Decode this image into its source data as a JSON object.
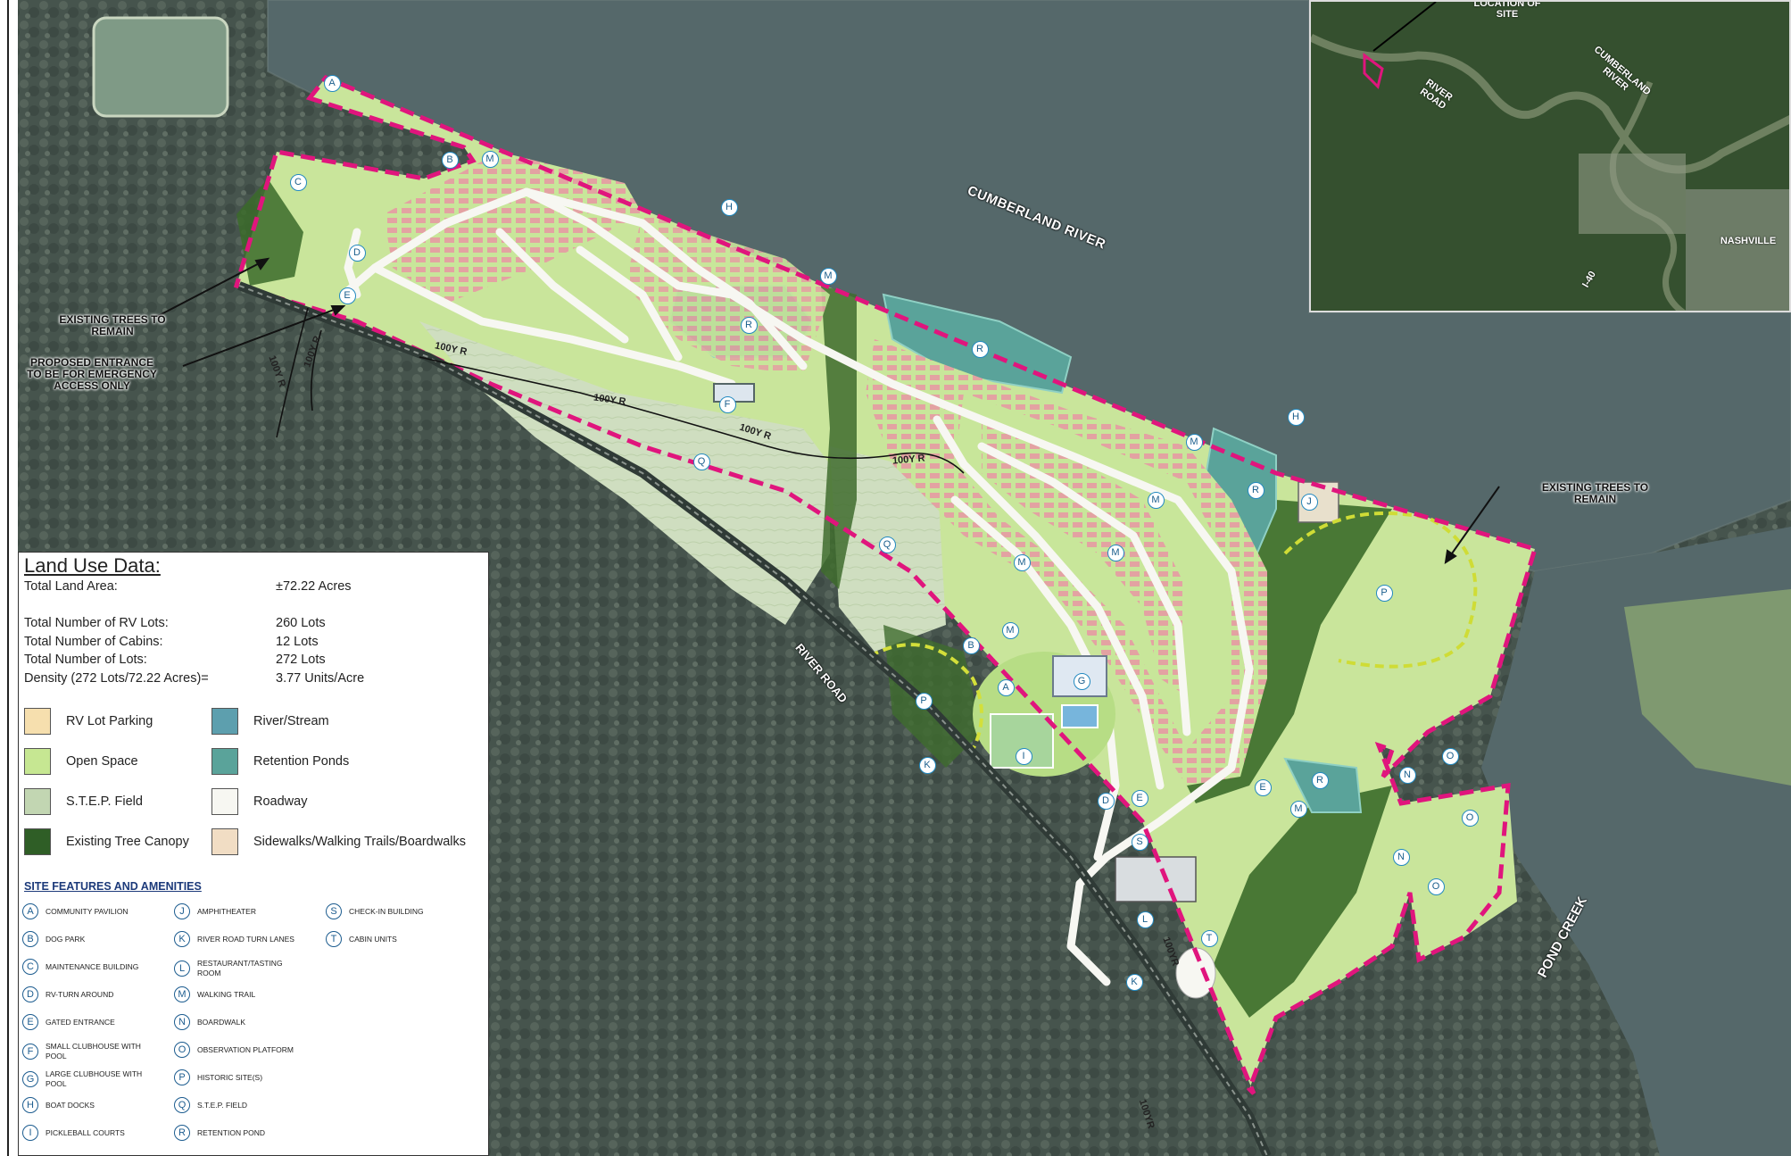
{
  "map": {
    "labels": {
      "cumberland_river": "CUMBERLAND RIVER",
      "river_road": "RIVER ROAD",
      "pond_creek": "POND CREEK",
      "existing_trees_left": "EXISTING TREES TO REMAIN",
      "existing_trees_right": "EXISTING TREES TO REMAIN",
      "emergency_entrance": "PROPOSED ENTRANCE TO BE FOR EMERGENCY ACCESS ONLY"
    },
    "flood_labels": [
      "100Y R",
      "100Y R",
      "100Y R",
      "100Y R",
      "100Y R",
      "100Y R",
      "100YR",
      "100YR"
    ],
    "markers": [
      {
        "id": "m-a1",
        "letter": "A"
      },
      {
        "id": "m-b1",
        "letter": "B"
      },
      {
        "id": "m-m1",
        "letter": "M"
      },
      {
        "id": "m-c",
        "letter": "C"
      },
      {
        "id": "m-d1",
        "letter": "D"
      },
      {
        "id": "m-e1",
        "letter": "E"
      },
      {
        "id": "m-h1",
        "letter": "H"
      },
      {
        "id": "m-m2",
        "letter": "M"
      },
      {
        "id": "m-r1",
        "letter": "R"
      },
      {
        "id": "m-f",
        "letter": "F"
      },
      {
        "id": "m-r2",
        "letter": "R"
      },
      {
        "id": "m-q1",
        "letter": "Q"
      },
      {
        "id": "m-h2",
        "letter": "H"
      },
      {
        "id": "m-m3",
        "letter": "M"
      },
      {
        "id": "m-m4",
        "letter": "M"
      },
      {
        "id": "m-r3",
        "letter": "R"
      },
      {
        "id": "m-j",
        "letter": "J"
      },
      {
        "id": "m-m5",
        "letter": "M"
      },
      {
        "id": "m-m6",
        "letter": "M"
      },
      {
        "id": "m-q2",
        "letter": "Q"
      },
      {
        "id": "m-p1",
        "letter": "P"
      },
      {
        "id": "m-m7",
        "letter": "M"
      },
      {
        "id": "m-b2",
        "letter": "B"
      },
      {
        "id": "m-a2",
        "letter": "A"
      },
      {
        "id": "m-g",
        "letter": "G"
      },
      {
        "id": "m-p2",
        "letter": "P"
      },
      {
        "id": "m-i",
        "letter": "I"
      },
      {
        "id": "m-k1",
        "letter": "K"
      },
      {
        "id": "m-d2",
        "letter": "D"
      },
      {
        "id": "m-e2",
        "letter": "E"
      },
      {
        "id": "m-e3",
        "letter": "E"
      },
      {
        "id": "m-m8",
        "letter": "M"
      },
      {
        "id": "m-r4",
        "letter": "R"
      },
      {
        "id": "m-s",
        "letter": "S"
      },
      {
        "id": "m-l",
        "letter": "L"
      },
      {
        "id": "m-t",
        "letter": "T"
      },
      {
        "id": "m-k2",
        "letter": "K"
      },
      {
        "id": "m-n1",
        "letter": "N"
      },
      {
        "id": "m-o1",
        "letter": "O"
      },
      {
        "id": "m-o2",
        "letter": "O"
      },
      {
        "id": "m-n2",
        "letter": "N"
      },
      {
        "id": "m-o3",
        "letter": "O"
      }
    ]
  },
  "inset": {
    "location_of_site": "LOCATION OF SITE",
    "river_road": "RIVER ROAD",
    "cumberland_river": "CUMBERLAND RIVER",
    "nashville": "NASHVILLE",
    "i40": "I-40"
  },
  "legend": {
    "title": "Land Use Data:",
    "rows": [
      {
        "label": "Total Land Area:",
        "value": "±72.22 Acres"
      },
      {
        "label": "Total Number of RV Lots:",
        "value": "260 Lots"
      },
      {
        "label": "Total Number of Cabins:",
        "value": "12 Lots"
      },
      {
        "label": "Total Number of Lots:",
        "value": "272 Lots"
      },
      {
        "label": "Density (272 Lots/72.22 Acres)=",
        "value": "3.77 Units/Acre"
      }
    ],
    "swatches": [
      {
        "label": "RV Lot Parking",
        "color": "#f6dfae"
      },
      {
        "label": "River/Stream",
        "color": "#5d9fae"
      },
      {
        "label": "Open Space",
        "color": "#c6e792"
      },
      {
        "label": "Retention Ponds",
        "color": "#5aa39a"
      },
      {
        "label": "S.T.E.P. Field",
        "color": "#c2d6b2"
      },
      {
        "label": "Roadway",
        "color": "#f7f7f2"
      },
      {
        "label": "Existing Tree Canopy",
        "color": "#2f5e26"
      },
      {
        "label": "Sidewalks/Walking Trails/Boardwalks",
        "color": "#f1ddc4"
      }
    ],
    "site_features_title": "SITE FEATURES AND AMENITIES",
    "features": [
      {
        "letter": "A",
        "label": "COMMUNITY PAVILION"
      },
      {
        "letter": "B",
        "label": "DOG PARK"
      },
      {
        "letter": "C",
        "label": "MAINTENANCE BUILDING"
      },
      {
        "letter": "D",
        "label": "RV-TURN AROUND"
      },
      {
        "letter": "E",
        "label": "GATED ENTRANCE"
      },
      {
        "letter": "F",
        "label": "SMALL CLUBHOUSE WITH POOL"
      },
      {
        "letter": "G",
        "label": "LARGE CLUBHOUSE WITH POOL"
      },
      {
        "letter": "H",
        "label": "BOAT DOCKS"
      },
      {
        "letter": "I",
        "label": "PICKLEBALL COURTS"
      },
      {
        "letter": "J",
        "label": "AMPHITHEATER"
      },
      {
        "letter": "K",
        "label": "RIVER ROAD TURN LANES"
      },
      {
        "letter": "L",
        "label": "RESTAURANT/TASTING ROOM"
      },
      {
        "letter": "M",
        "label": "WALKING TRAIL"
      },
      {
        "letter": "N",
        "label": "BOARDWALK"
      },
      {
        "letter": "O",
        "label": "OBSERVATION PLATFORM"
      },
      {
        "letter": "P",
        "label": "HISTORIC SITE(S)"
      },
      {
        "letter": "Q",
        "label": "S.T.E.P. FIELD"
      },
      {
        "letter": "R",
        "label": "RETENTION POND"
      },
      {
        "letter": "S",
        "label": "CHECK-IN BUILDING"
      },
      {
        "letter": "T",
        "label": "CABIN UNITS"
      }
    ]
  }
}
